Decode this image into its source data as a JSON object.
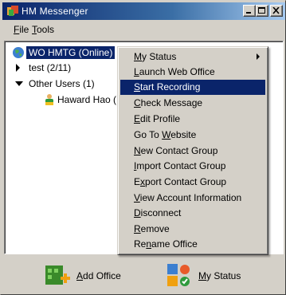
{
  "window": {
    "title": "HM Messenger",
    "colors": {
      "titlebar_start": "#0a246a",
      "titlebar_end": "#a6caf0",
      "face": "#d4d0c8",
      "selection": "#0a246a"
    }
  },
  "menubar": {
    "file": {
      "label": "File",
      "mnemonic": "F",
      "rest": "ile"
    },
    "tools": {
      "label": "Tools",
      "mnemonic": "T",
      "rest": "ools"
    }
  },
  "tree": {
    "root": {
      "label": "WO HMTG (Online)",
      "icon": "globe-icon"
    },
    "groups": [
      {
        "label": "test (2/11)",
        "expanded": false
      },
      {
        "label": "Other Users (1)",
        "expanded": true
      }
    ],
    "users": [
      {
        "label": "Haward Hao (",
        "icon": "user-icon"
      }
    ]
  },
  "context_menu": {
    "items": [
      {
        "pre": "",
        "mn": "M",
        "post": "y Status",
        "has_submenu": true,
        "highlighted": false
      },
      {
        "pre": "",
        "mn": "L",
        "post": "aunch Web Office",
        "highlighted": false
      },
      {
        "pre": "",
        "mn": "S",
        "post": "tart Recording",
        "highlighted": true
      },
      {
        "pre": "",
        "mn": "C",
        "post": "heck Message",
        "highlighted": false
      },
      {
        "pre": "",
        "mn": "E",
        "post": "dit Profile",
        "highlighted": false
      },
      {
        "pre": "Go To ",
        "mn": "W",
        "post": "ebsite",
        "highlighted": false
      },
      {
        "pre": "",
        "mn": "N",
        "post": "ew Contact Group",
        "highlighted": false
      },
      {
        "pre": "",
        "mn": "I",
        "post": "mport Contact Group",
        "highlighted": false
      },
      {
        "pre": "E",
        "mn": "x",
        "post": "port Contact Group",
        "highlighted": false
      },
      {
        "pre": "",
        "mn": "V",
        "post": "iew Account Information",
        "highlighted": false
      },
      {
        "pre": "",
        "mn": "D",
        "post": "isconnect",
        "highlighted": false
      },
      {
        "pre": "",
        "mn": "R",
        "post": "emove",
        "highlighted": false
      },
      {
        "pre": "Re",
        "mn": "n",
        "post": "ame Office",
        "highlighted": false
      }
    ]
  },
  "bottom": {
    "add_office": {
      "mn": "A",
      "post": "dd Office",
      "icon": "add-office-icon"
    },
    "my_status": {
      "mn": "M",
      "post": "y Status",
      "icon": "status-icon"
    }
  }
}
